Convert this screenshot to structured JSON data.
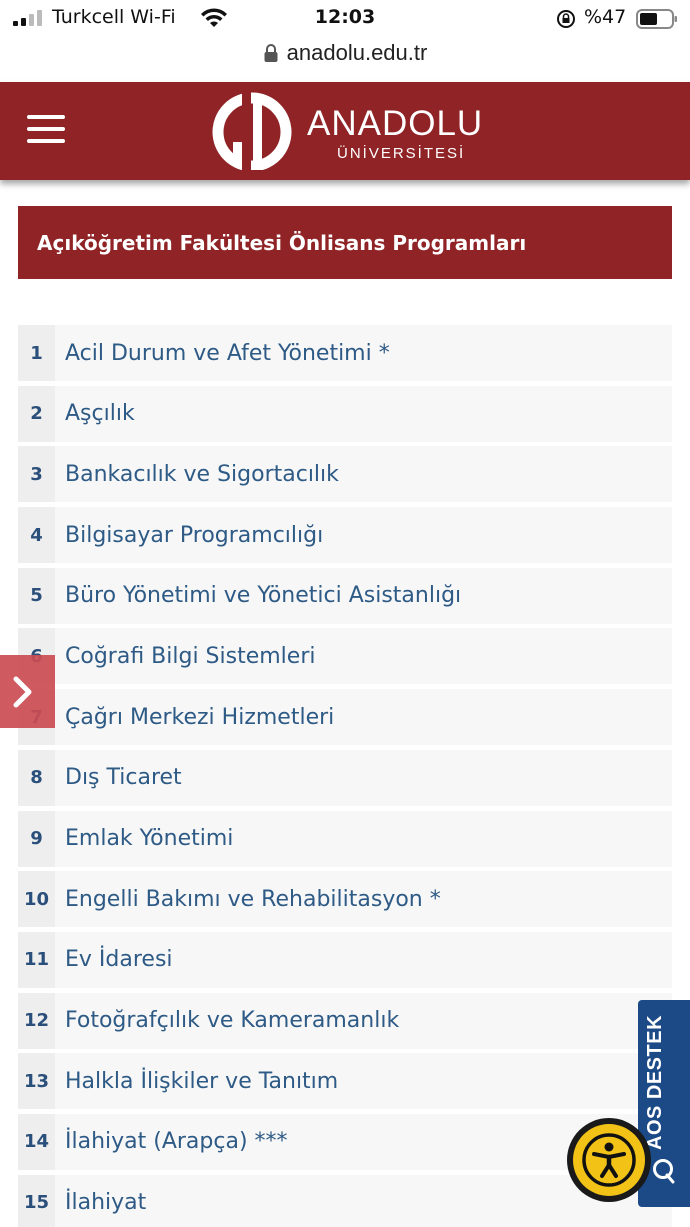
{
  "status_bar": {
    "carrier": "Turkcell Wi-Fi",
    "time": "12:03",
    "battery": "%47"
  },
  "browser": {
    "url": "anadolu.edu.tr"
  },
  "header": {
    "logo_name": "ANADOLU",
    "logo_sub": "ÜNİVERSİTESİ"
  },
  "section": {
    "title": "Açıköğretim Fakültesi Önlisans Programları"
  },
  "programs": [
    {
      "num": "1",
      "name": "Acil Durum ve Afet Yönetimi *"
    },
    {
      "num": "2",
      "name": "Aşçılık"
    },
    {
      "num": "3",
      "name": "Bankacılık ve Sigortacılık"
    },
    {
      "num": "4",
      "name": "Bilgisayar Programcılığı"
    },
    {
      "num": "5",
      "name": "Büro Yönetimi ve Yönetici Asistanlığı"
    },
    {
      "num": "6",
      "name": "Coğrafi Bilgi Sistemleri"
    },
    {
      "num": "7",
      "name": "Çağrı Merkezi Hizmetleri"
    },
    {
      "num": "8",
      "name": "Dış Ticaret"
    },
    {
      "num": "9",
      "name": "Emlak Yönetimi"
    },
    {
      "num": "10",
      "name": "Engelli Bakımı ve Rehabilitasyon *"
    },
    {
      "num": "11",
      "name": "Ev İdaresi"
    },
    {
      "num": "12",
      "name": "Fotoğrafçılık ve Kameramanlık"
    },
    {
      "num": "13",
      "name": "Halkla İlişkiler ve Tanıtım"
    },
    {
      "num": "14",
      "name": "İlahiyat (Arapça) ***"
    },
    {
      "num": "15",
      "name": "İlahiyat"
    }
  ],
  "widgets": {
    "aos_label": "AOS DESTEK"
  },
  "colors": {
    "brand_red": "#8f2326",
    "link_blue": "#2e5a86",
    "aos_blue": "#1c4a86",
    "access_yellow": "#f2c316"
  }
}
